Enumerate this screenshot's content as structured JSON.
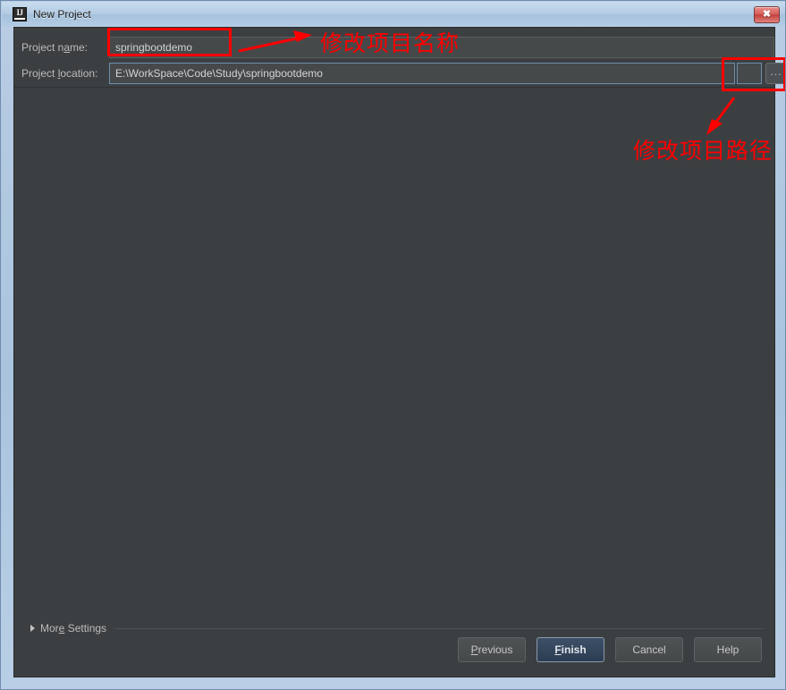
{
  "window": {
    "title": "New Project",
    "app_icon": "intellij-idea-icon",
    "close_icon": "close-icon",
    "close_label": "✖"
  },
  "form": {
    "project_name": {
      "label_prefix": "Project n",
      "label_mnemonic": "a",
      "label_suffix": "me:",
      "value": "springbootdemo"
    },
    "project_location": {
      "label_prefix": "Project ",
      "label_mnemonic": "l",
      "label_suffix": "ocation:",
      "value": "E:\\WorkSpace\\Code\\Study\\springbootdemo"
    },
    "browse_button_label": "..."
  },
  "more_settings": {
    "label_prefix": "Mor",
    "label_mnemonic": "e",
    "label_suffix": " Settings",
    "expanded": false,
    "arrow_icon": "chevron-right-icon"
  },
  "buttons": [
    {
      "name": "previous",
      "prefix": "",
      "mnemonic": "P",
      "suffix": "revious",
      "default": false
    },
    {
      "name": "finish",
      "prefix": "",
      "mnemonic": "F",
      "suffix": "inish",
      "default": true
    },
    {
      "name": "cancel",
      "prefix": "Cancel",
      "mnemonic": "",
      "suffix": "",
      "default": false
    },
    {
      "name": "help",
      "prefix": "Help",
      "mnemonic": "",
      "suffix": "",
      "default": false
    }
  ],
  "annotations": {
    "color": "#ff0000",
    "name_note": "修改项目名称",
    "path_note": "修改项目路径"
  },
  "colors": {
    "panel_bg": "#3c3f41",
    "field_bg": "#45494a",
    "titlebar": "#aac4de",
    "accent_focus": "#6d8faf",
    "annotation": "#ff0000"
  }
}
